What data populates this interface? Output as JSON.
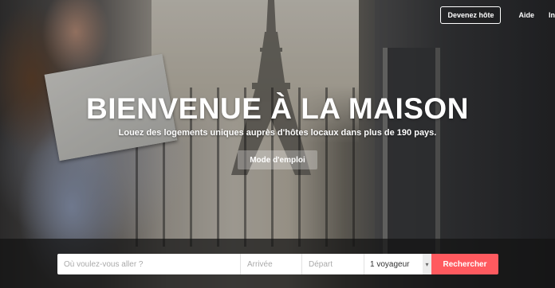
{
  "nav": {
    "host_label": "Devenez hôte",
    "help_label": "Aide",
    "cut_label": "In"
  },
  "hero": {
    "title": "BIENVENUE À LA MAISON",
    "subtitle": "Louez des logements uniques auprès d'hôtes locaux dans plus de 190 pays.",
    "howto_label": "Mode d'emploi"
  },
  "search": {
    "where_placeholder": "Où voulez-vous aller ?",
    "arrive_placeholder": "Arrivée",
    "depart_placeholder": "Départ",
    "guests_value": "1 voyageur",
    "search_label": "Rechercher",
    "chevron_icon": "chevron-down-icon"
  },
  "colors": {
    "accent": "#ff5a5f"
  }
}
